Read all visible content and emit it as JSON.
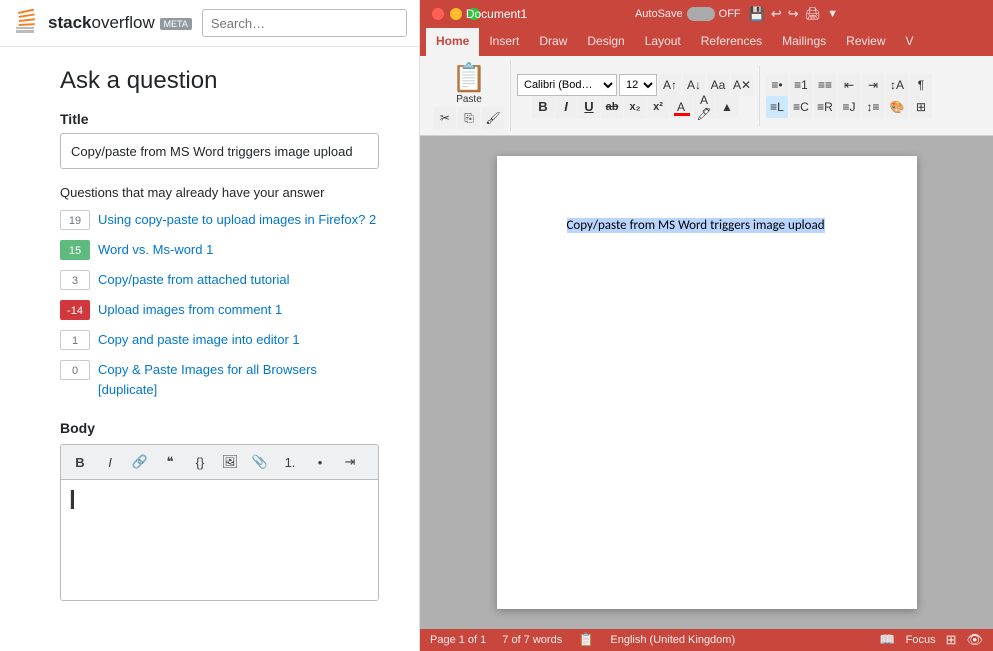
{
  "so": {
    "logo": {
      "bold": "stack",
      "normal": "overflow",
      "meta": "META"
    },
    "search_placeholder": "Search…",
    "page_title": "Ask a question",
    "title_label": "Title",
    "title_value": "Copy/paste from MS Word triggers image upload",
    "suggestions_label": "Questions that may already have your answer",
    "suggestions": [
      {
        "score": "19",
        "score_type": "normal",
        "text": "Using copy-paste to upload images in Firefox? 2"
      },
      {
        "score": "15",
        "score_type": "green",
        "text": "Word vs. Ms-word 1"
      },
      {
        "score": "3",
        "score_type": "normal",
        "text": "Copy/paste from attached tutorial"
      },
      {
        "score": "-14",
        "score_type": "negative",
        "text": "Upload images from comment 1"
      },
      {
        "score": "1",
        "score_type": "normal",
        "text": "Copy and paste image into editor 1"
      },
      {
        "score": "0",
        "score_type": "normal",
        "text": "Copy & Paste Images for all Browsers [duplicate]"
      }
    ],
    "body_label": "Body",
    "toolbar_buttons": [
      {
        "name": "bold-btn",
        "label": "B"
      },
      {
        "name": "italic-btn",
        "label": "I"
      },
      {
        "name": "link-btn",
        "label": "🔗"
      },
      {
        "name": "blockquote-btn",
        "label": "❝"
      },
      {
        "name": "code-btn",
        "label": "{}"
      },
      {
        "name": "image-btn",
        "label": "🖼"
      },
      {
        "name": "attach-btn",
        "label": "📎"
      },
      {
        "name": "ol-btn",
        "label": "1."
      },
      {
        "name": "ul-btn",
        "label": "•"
      },
      {
        "name": "indent-btn",
        "label": "⇥"
      }
    ]
  },
  "word": {
    "titlebar": {
      "autosave_label": "AutoSave",
      "toggle_label": "OFF",
      "title": "Document1"
    },
    "tabs": [
      {
        "id": "home",
        "label": "Home",
        "active": true
      },
      {
        "id": "insert",
        "label": "Insert"
      },
      {
        "id": "draw",
        "label": "Draw"
      },
      {
        "id": "design",
        "label": "Design"
      },
      {
        "id": "layout",
        "label": "Layout"
      },
      {
        "id": "references",
        "label": "References"
      },
      {
        "id": "mailings",
        "label": "Mailings"
      },
      {
        "id": "review",
        "label": "Review"
      },
      {
        "id": "view",
        "label": "V"
      }
    ],
    "ribbon": {
      "paste_label": "Paste",
      "font_family": "Calibri (Bod…",
      "font_size": "12",
      "bold": "B",
      "italic": "I",
      "underline": "U",
      "strikethrough": "ab",
      "subscript": "x₂",
      "superscript": "x²"
    },
    "document": {
      "selected_text": "Copy/paste from MS Word triggers image upload"
    },
    "statusbar": {
      "page": "Page 1 of 1",
      "words": "7 of 7 words",
      "language": "English (United Kingdom)",
      "focus": "Focus"
    }
  }
}
